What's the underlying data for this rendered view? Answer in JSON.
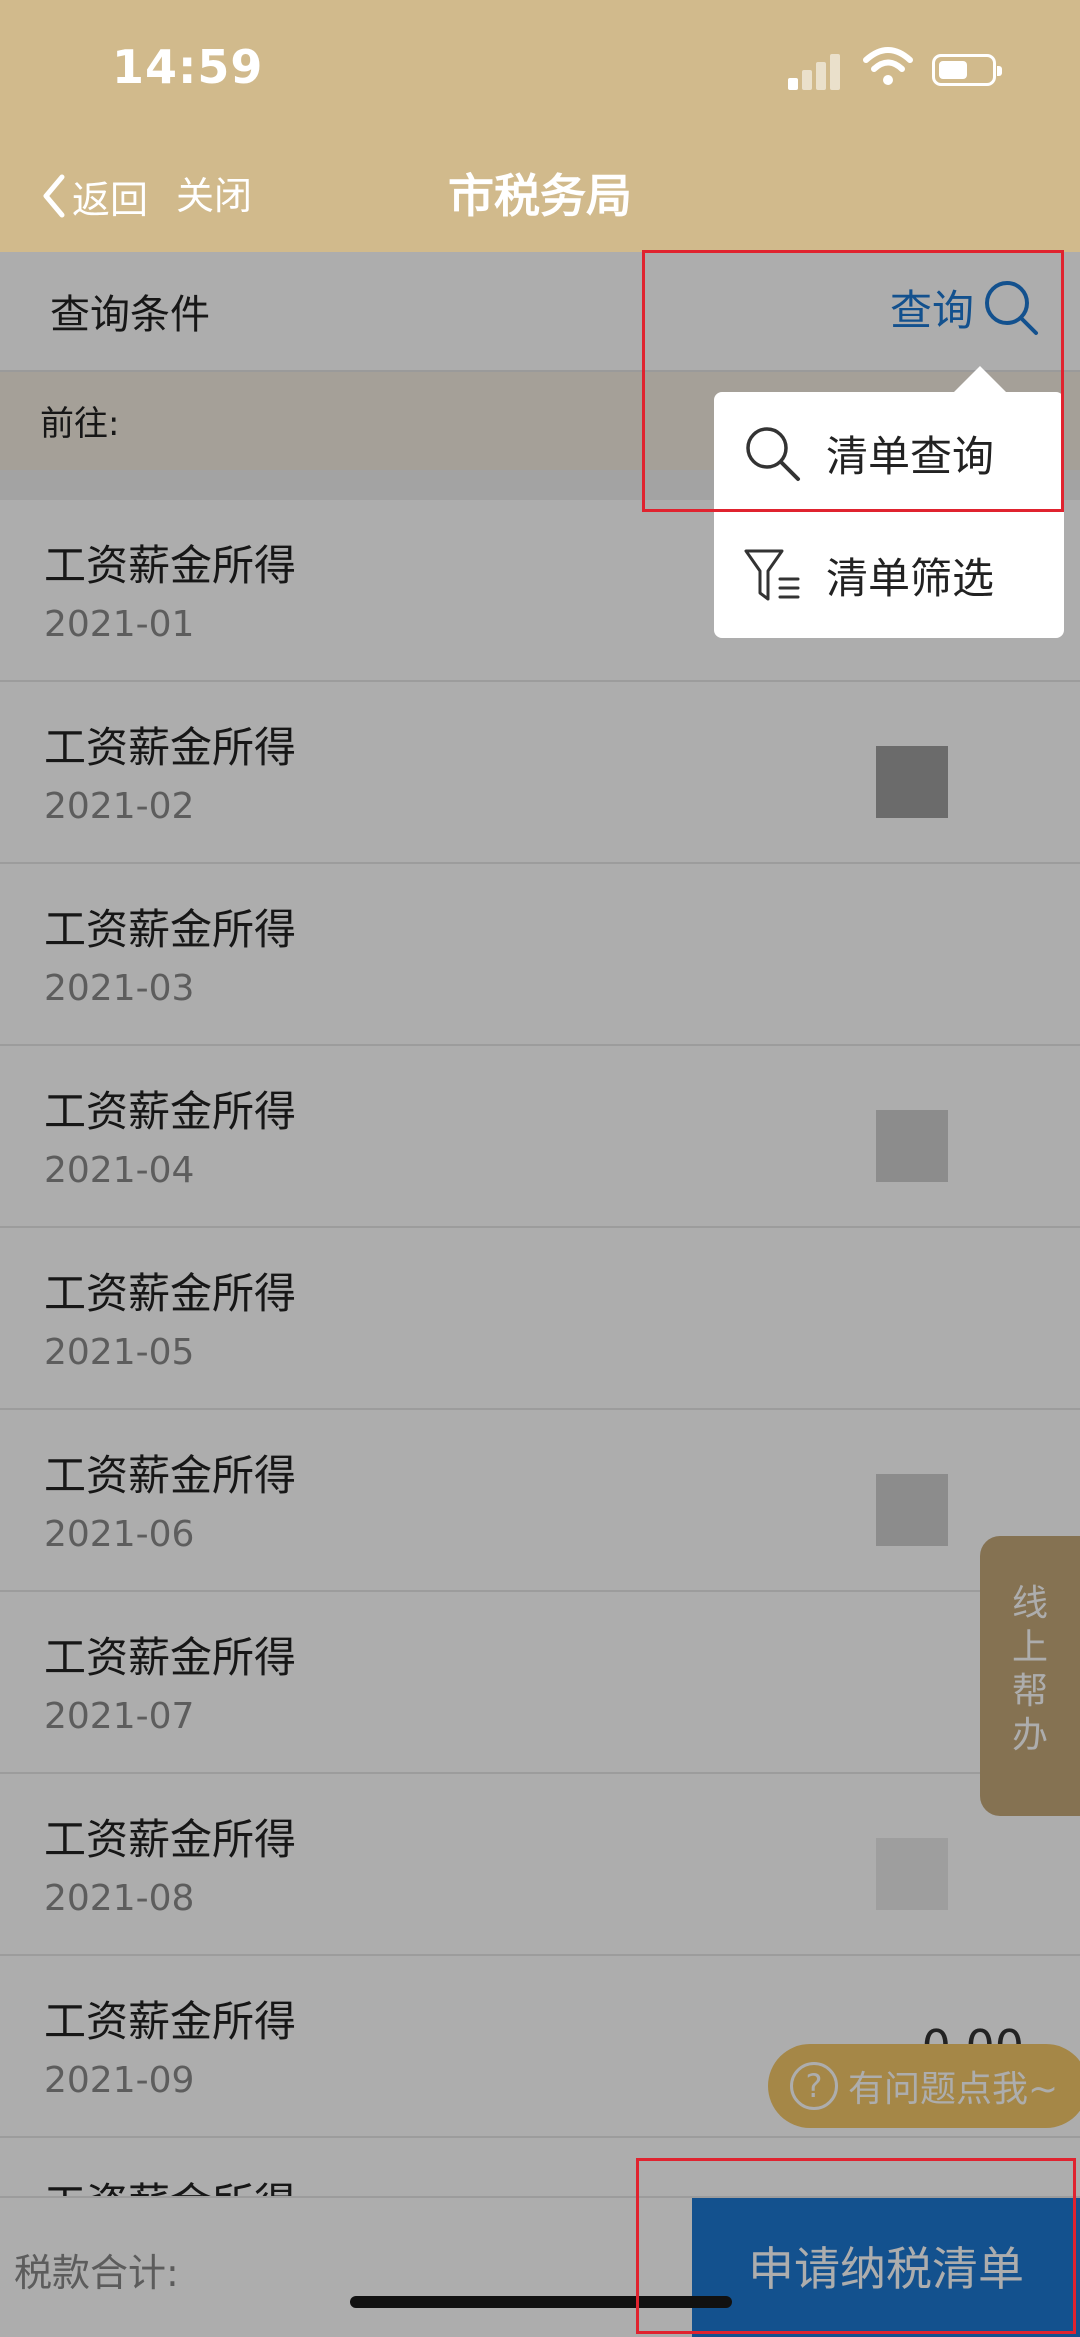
{
  "status_bar": {
    "time": "14:59"
  },
  "nav": {
    "back_label": "返回",
    "close_label": "关闭",
    "title": "市税务局"
  },
  "query": {
    "label": "查询条件",
    "button_label": "查询"
  },
  "goto": {
    "label": "前往:"
  },
  "list": {
    "items": [
      {
        "title": "工资薪金所得",
        "date": "2021-01"
      },
      {
        "title": "工资薪金所得",
        "date": "2021-02"
      },
      {
        "title": "工资薪金所得",
        "date": "2021-03"
      },
      {
        "title": "工资薪金所得",
        "date": "2021-04"
      },
      {
        "title": "工资薪金所得",
        "date": "2021-05"
      },
      {
        "title": "工资薪金所得",
        "date": "2021-06"
      },
      {
        "title": "工资薪金所得",
        "date": "2021-07"
      },
      {
        "title": "工资薪金所得",
        "date": "2021-08"
      },
      {
        "title": "工资薪金所得",
        "date": "2021-09",
        "value": "0.00"
      },
      {
        "title": "工资薪金所得",
        "date": ""
      }
    ]
  },
  "popup": {
    "items": [
      {
        "label": "清单查询",
        "icon": "search-icon"
      },
      {
        "label": "清单筛选",
        "icon": "filter-icon"
      }
    ]
  },
  "help": {
    "tab_chars": [
      "线",
      "上",
      "帮",
      "办"
    ],
    "pill_label": "有问题点我~"
  },
  "bottom": {
    "total_label": "税款合计:",
    "apply_label": "申请纳税清单"
  },
  "colors": {
    "header_bg": "#d1ba8c",
    "accent_blue": "#1d78d2",
    "help_pill": "#f3c869",
    "help_tab": "#c4a87a",
    "annotation_red": "#e0232f"
  }
}
